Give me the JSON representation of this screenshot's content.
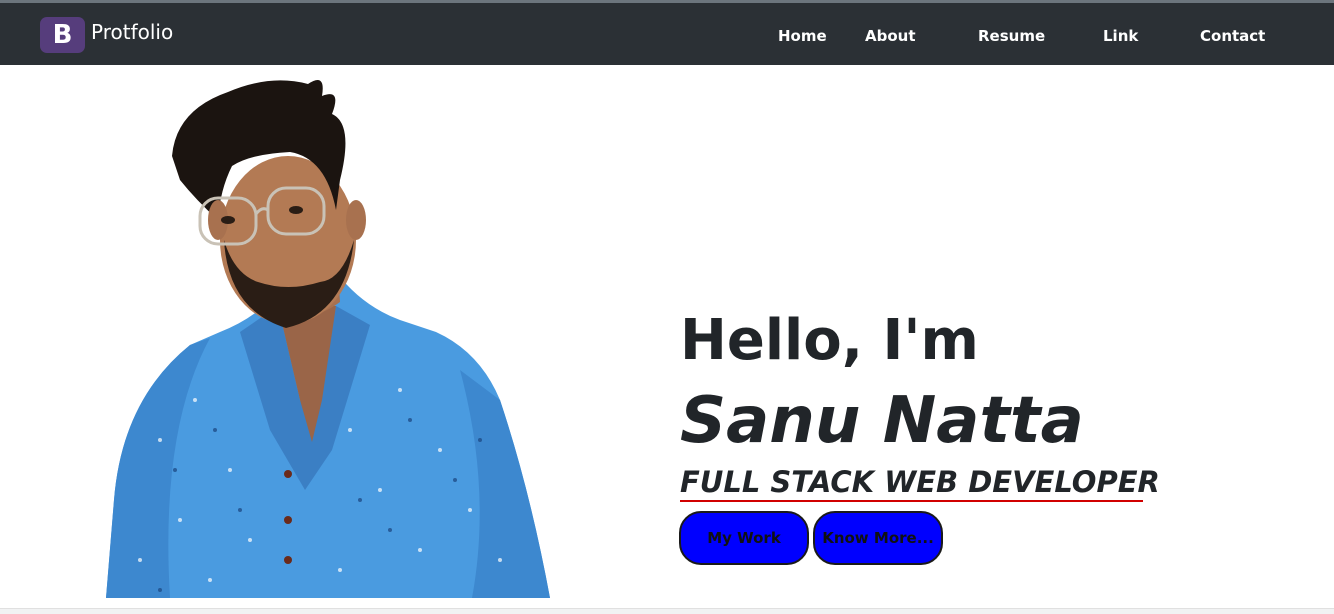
{
  "navbar": {
    "brand_letter": "B",
    "brand_text": "Protfolio",
    "links": [
      "Home",
      "About",
      "Resume",
      "Link",
      "Contact"
    ]
  },
  "hero": {
    "greeting": "Hello, I'm",
    "name": "Sanu Natta",
    "role": "FULL STACK WEB DEVELOPER",
    "buttons": [
      "My Work",
      "Know More..."
    ]
  },
  "colors": {
    "navbar_bg": "#2b3035",
    "brand_logo": "#563d7c",
    "button_bg": "#0000ff",
    "underline": "#d10000",
    "shirt": "#4a9be0"
  },
  "icons": {
    "brand_logo": "bootstrap-logo-icon"
  }
}
